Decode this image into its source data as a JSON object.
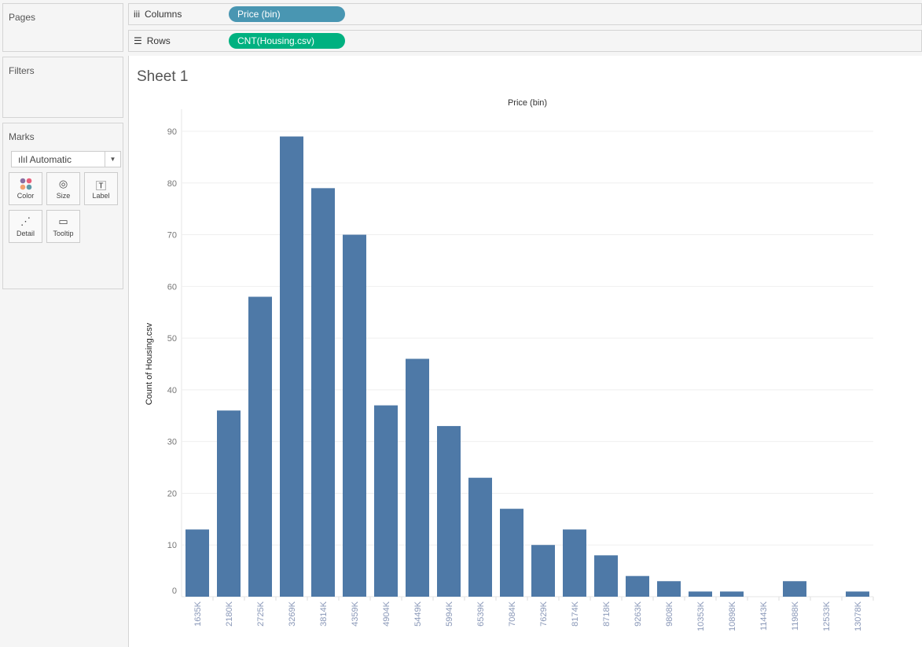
{
  "panels": {
    "pages": "Pages",
    "filters": "Filters",
    "marks": "Marks"
  },
  "marks": {
    "type": "Automatic",
    "buttons": [
      {
        "label": "Color",
        "icon": "color-icon"
      },
      {
        "label": "Size",
        "icon": "size-icon"
      },
      {
        "label": "Label",
        "icon": "label-icon"
      },
      {
        "label": "Detail",
        "icon": "detail-icon"
      },
      {
        "label": "Tooltip",
        "icon": "tooltip-icon"
      }
    ]
  },
  "shelves": {
    "columns_label": "Columns",
    "columns_pill": "Price (bin)",
    "columns_color": "#4996b2",
    "rows_label": "Rows",
    "rows_pill": "CNT(Housing.csv)",
    "rows_color": "#00b180"
  },
  "sheet_title": "Sheet 1",
  "chart_data": {
    "type": "bar",
    "title": "Price (bin)",
    "xlabel": "",
    "ylabel": "Count of Housing.csv",
    "ylim": [
      0,
      90
    ],
    "yticks": [
      0,
      10,
      20,
      30,
      40,
      50,
      60,
      70,
      80,
      90
    ],
    "grid": true,
    "bar_color": "#4e79a7",
    "categories": [
      "1635K",
      "2180K",
      "2725K",
      "3269K",
      "3814K",
      "4359K",
      "4904K",
      "5449K",
      "5994K",
      "6539K",
      "7084K",
      "7629K",
      "8174K",
      "8718K",
      "9263K",
      "9808K",
      "10353K",
      "10898K",
      "11443K",
      "11988K",
      "12533K",
      "13078K"
    ],
    "values": [
      13,
      36,
      58,
      89,
      79,
      70,
      37,
      46,
      33,
      23,
      17,
      10,
      13,
      8,
      4,
      3,
      1,
      1,
      0,
      3,
      0,
      1
    ]
  }
}
